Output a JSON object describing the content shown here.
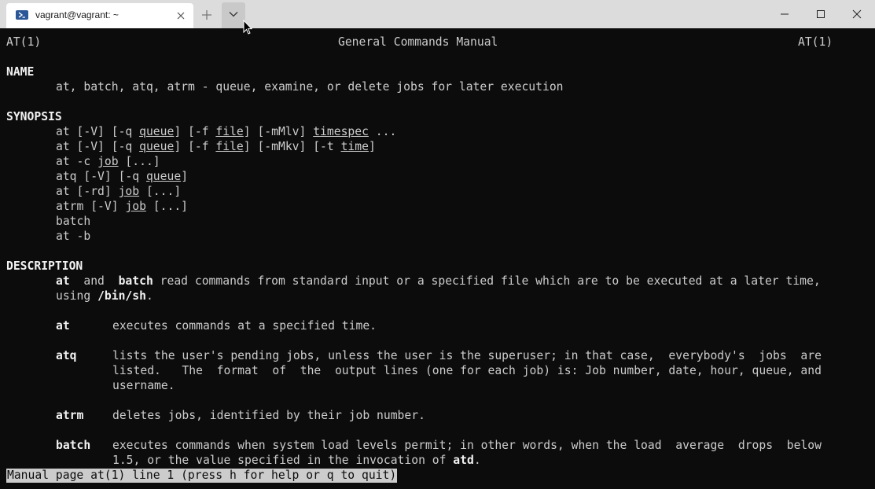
{
  "tab": {
    "title": "vagrant@vagrant: ~",
    "icon": "powershell-icon"
  },
  "titlebar": {
    "new_tab_icon": "plus-icon",
    "dropdown_icon": "chevron-down-icon",
    "window_controls": [
      "minimize-icon",
      "maximize-icon",
      "close-icon"
    ]
  },
  "man": {
    "header_left": "AT(1)",
    "header_center": "General Commands Manual",
    "header_right": "AT(1)",
    "name_heading": "NAME",
    "name_text": "at, batch, atq, atrm - queue, examine, or delete jobs for later execution",
    "synopsis_heading": "SYNOPSIS",
    "synopsis": [
      {
        "a": "at [-V] [-q ",
        "b": "queue",
        "c": "] [-f ",
        "d": "file",
        "e": "] [-mMlv] ",
        "f": "timespec",
        "g": " ..."
      },
      {
        "a": "at [-V] [-q ",
        "b": "queue",
        "c": "] [-f ",
        "d": "file",
        "e": "] [-mMkv] [-t ",
        "f": "time",
        "g": "]"
      },
      {
        "a": "at -c ",
        "b": "job",
        "c": " [...]"
      },
      {
        "a": "atq [-V] [-q ",
        "b": "queue",
        "c": "]"
      },
      {
        "a": "at [-rd] ",
        "b": "job",
        "c": " [...]"
      },
      {
        "a": "atrm [-V] ",
        "b": "job",
        "c": " [...]"
      },
      {
        "a": "batch"
      },
      {
        "a": "at -b"
      }
    ],
    "description_heading": "DESCRIPTION",
    "desc_intro": {
      "cmd1": "at",
      "and": "  and  ",
      "cmd2": "batch",
      "rest": " read commands from standard input or a specified file which are to be executed at a later time,",
      "line2_pre": "using ",
      "shell": "/bin/sh",
      "line2_post": "."
    },
    "items": [
      {
        "cmd": "at",
        "lines": [
          "executes commands at a specified time."
        ]
      },
      {
        "cmd": "atq",
        "lines": [
          "lists the user's pending jobs, unless the user is the superuser; in that case,  everybody's  jobs  are",
          "listed.   The  format  of  the  output lines (one for each job) is: Job number, date, hour, queue, and",
          "username."
        ]
      },
      {
        "cmd": "atrm",
        "lines": [
          "deletes jobs, identified by their job number."
        ]
      },
      {
        "cmd": "batch",
        "lines": [
          "executes commands when system load levels permit; in other words, when the load  average  drops  below"
        ],
        "last_pre": "1.5, or the value specified in the invocation of ",
        "last_bold": "atd",
        "last_post": "."
      }
    ],
    "status": "Manual page at(1) line 1 (press h for help or q to quit)"
  }
}
